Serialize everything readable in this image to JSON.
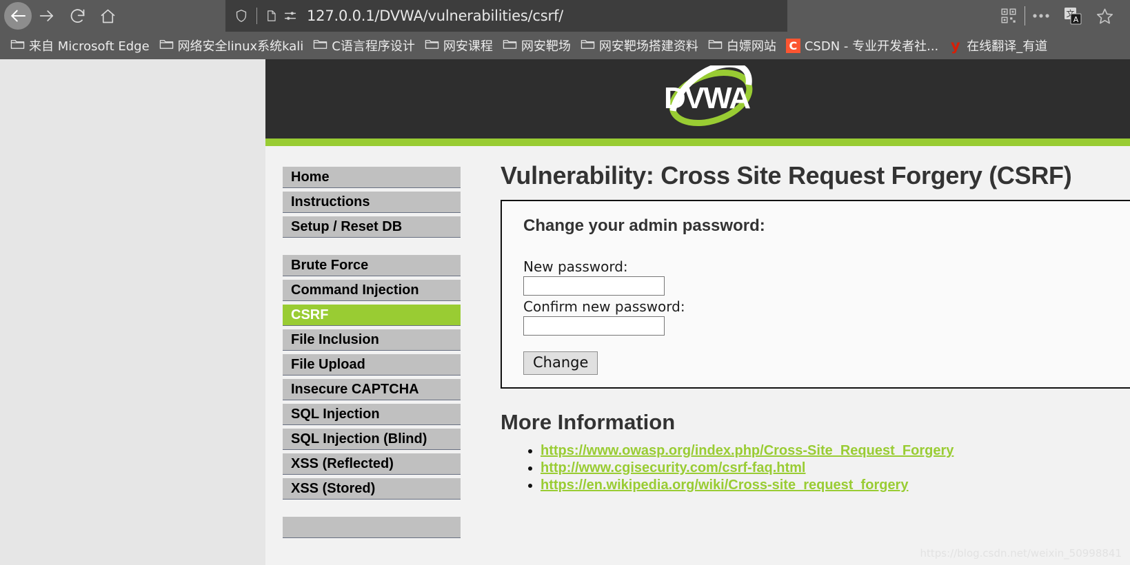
{
  "browser": {
    "nav": {
      "back_label": "back-arrow",
      "forward_label": "forward-arrow",
      "reload_label": "reload",
      "home_label": "home"
    },
    "url": {
      "value": "127.0.0.1/DVWA/vulnerabilities/csrf/",
      "shield_icon": "shield-icon",
      "page_icon": "page-icon",
      "permissions_icon": "permissions-icon"
    },
    "toolbar_right": {
      "qr_icon": "qr-code-icon",
      "more_icon": "more-ellipsis-icon",
      "translate_icon": "translate-icon",
      "bookmark_icon": "star-bookmark-icon"
    },
    "bookmarks": [
      {
        "label": "来自 Microsoft Edge",
        "icon": "folder-icon"
      },
      {
        "label": "网络安全linux系统kali",
        "icon": "folder-icon"
      },
      {
        "label": "C语言程序设计",
        "icon": "folder-icon"
      },
      {
        "label": "网安课程",
        "icon": "folder-icon"
      },
      {
        "label": "网安靶场",
        "icon": "folder-icon"
      },
      {
        "label": "网安靶场搭建资料",
        "icon": "folder-icon"
      },
      {
        "label": "白嫖网站",
        "icon": "folder-icon"
      },
      {
        "label": "CSDN - 专业开发者社...",
        "icon": "csdn-favicon",
        "favicon_text": "C"
      },
      {
        "label": "在线翻译_有道",
        "icon": "youdao-favicon",
        "favicon_text": "y"
      }
    ]
  },
  "site": {
    "logo_text": "DVWA",
    "accent_color": "#99cc33",
    "header_color": "#2e2e2e"
  },
  "sidebar": {
    "groups": [
      {
        "items": [
          {
            "label": "Home",
            "selected": false
          },
          {
            "label": "Instructions",
            "selected": false
          },
          {
            "label": "Setup / Reset DB",
            "selected": false
          }
        ]
      },
      {
        "items": [
          {
            "label": "Brute Force",
            "selected": false
          },
          {
            "label": "Command Injection",
            "selected": false
          },
          {
            "label": "CSRF",
            "selected": true
          },
          {
            "label": "File Inclusion",
            "selected": false
          },
          {
            "label": "File Upload",
            "selected": false
          },
          {
            "label": "Insecure CAPTCHA",
            "selected": false
          },
          {
            "label": "SQL Injection",
            "selected": false
          },
          {
            "label": "SQL Injection (Blind)",
            "selected": false
          },
          {
            "label": "XSS (Reflected)",
            "selected": false
          },
          {
            "label": "XSS (Stored)",
            "selected": false
          }
        ]
      },
      {
        "items": [
          {
            "label": "",
            "selected": false
          }
        ]
      }
    ]
  },
  "main": {
    "page_title": "Vulnerability: Cross Site Request Forgery (CSRF)",
    "form": {
      "title": "Change your admin password:",
      "new_password_label": "New password:",
      "new_password_value": "",
      "confirm_password_label": "Confirm new password:",
      "confirm_password_value": "",
      "submit_label": "Change"
    },
    "more_information": {
      "heading": "More Information",
      "links": [
        "https://www.owasp.org/index.php/Cross-Site_Request_Forgery",
        "http://www.cgisecurity.com/csrf-faq.html",
        "https://en.wikipedia.org/wiki/Cross-site_request_forgery"
      ]
    }
  },
  "watermark": "https://blog.csdn.net/weixin_50998841"
}
